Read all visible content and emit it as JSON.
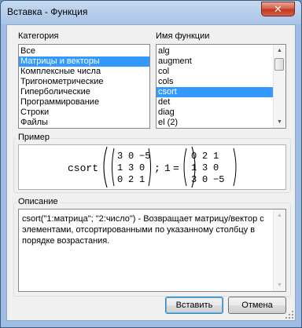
{
  "window": {
    "title": "Вставка - Функция",
    "close_label": "✕"
  },
  "category": {
    "label": "Категория",
    "items": [
      "Все",
      "Матрицы и векторы",
      "Комплексные числа",
      "Тригонометрические",
      "Гиперболические",
      "Программирование",
      "Строки",
      "Файлы"
    ],
    "selected_index": 1
  },
  "function_name": {
    "label": "Имя функции",
    "items": [
      "alg",
      "augment",
      "col",
      "cols",
      "csort",
      "det",
      "diag",
      "el (2)"
    ],
    "selected_index": 4
  },
  "example": {
    "label": "Пример",
    "func": "csort",
    "matrix_in": [
      [
        "3",
        "0",
        "−5"
      ],
      [
        "1",
        "3",
        "0"
      ],
      [
        "0",
        "2",
        "1"
      ]
    ],
    "separator": ";",
    "arg": "1",
    "equals": "=",
    "matrix_out": [
      [
        "0",
        "2",
        "1"
      ],
      [
        "1",
        "3",
        "0"
      ],
      [
        "3",
        "0",
        "−5"
      ]
    ]
  },
  "description": {
    "label": "Описание",
    "text": "csort(\"1:матрица\"; \"2:число\") - Возвращает матрицу/вектор с элементами, отсортированными по указанному столбцу в порядке возрастания."
  },
  "buttons": {
    "insert": "Вставить",
    "cancel": "Отмена"
  }
}
